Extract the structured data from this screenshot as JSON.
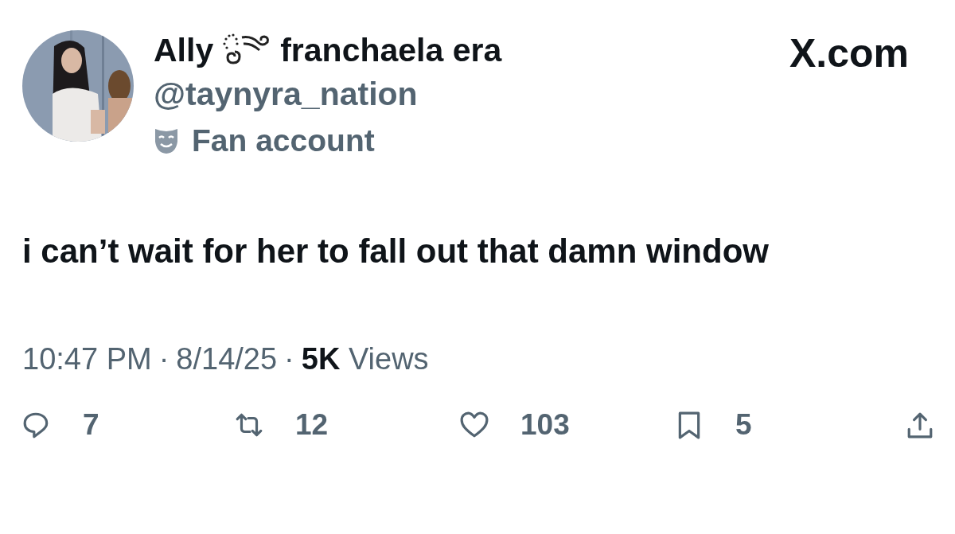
{
  "site": "X.com",
  "author": {
    "name_start": "Ally",
    "name_end": "franchaela era",
    "handle": "@taynyra_nation",
    "label": "Fan account"
  },
  "text": "i can’t wait for her to fall out that damn window",
  "meta": {
    "time": "10:47 PM",
    "separators": [
      "·",
      "·"
    ],
    "date": "8/14/25",
    "views_count": "5K",
    "views_label": "Views"
  },
  "actions": [
    {
      "kind": "reply",
      "count": "7"
    },
    {
      "kind": "repost",
      "count": "12"
    },
    {
      "kind": "like",
      "count": "103"
    },
    {
      "kind": "bookmark",
      "count": "5"
    },
    {
      "kind": "share"
    }
  ]
}
